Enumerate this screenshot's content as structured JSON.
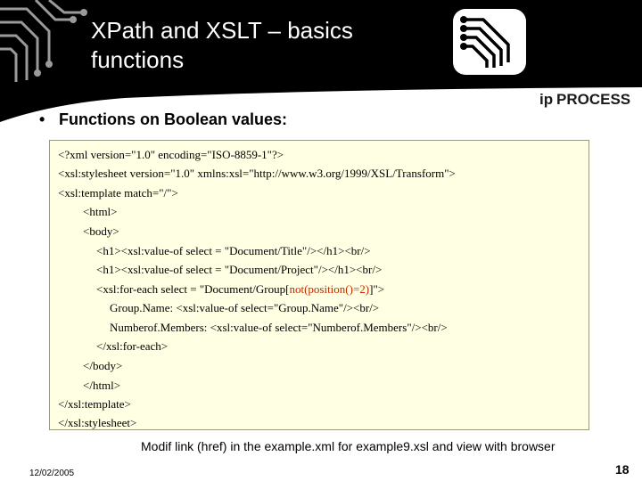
{
  "slide": {
    "title_line1": "XPath and XSLT – basics",
    "title_line2": "functions",
    "logo": {
      "prefix": "ip",
      "word": "PROCESS"
    },
    "bullet": "•",
    "bullet_text": "Functions on Boolean values:",
    "code": {
      "line1": "<?xml version=\"1.0\" encoding=\"ISO-8859-1\"?>",
      "line2": "<xsl:stylesheet version=\"1.0\" xmlns:xsl=\"http://www.w3.org/1999/XSL/Transform\">",
      "line3": "<xsl:template match=\"/\">",
      "line4": "<html>",
      "line5": "<body>",
      "line6": "<h1><xsl:value-of select = \"Document/Title\"/></h1><br/>",
      "line7": "<h1><xsl:value-of select = \"Document/Project\"/></h1><br/>",
      "line8_pre": "<xsl:for-each select = \"Document/Group[",
      "line8_hl": "not(position()=2)",
      "line8_post": "]\">",
      "line9": "Group.Name: <xsl:value-of select=\"Group.Name\"/><br/>",
      "line10": "Numberof.Members: <xsl:value-of select=\"Numberof.Members\"/><br/>",
      "line11": "</xsl:for-each>",
      "line12": "</body>",
      "line13": "</html>",
      "line14": "</xsl:template>",
      "line15": "</xsl:stylesheet>"
    },
    "note": "Modif link (href) in the example.xml for example9.xsl and view with browser",
    "date": "12/02/2005",
    "page_number": "18"
  },
  "colors": {
    "header": "#000000",
    "code_background": "#ffffe3",
    "highlight": "#c22a00",
    "logo_text": "#1a1a1a"
  }
}
